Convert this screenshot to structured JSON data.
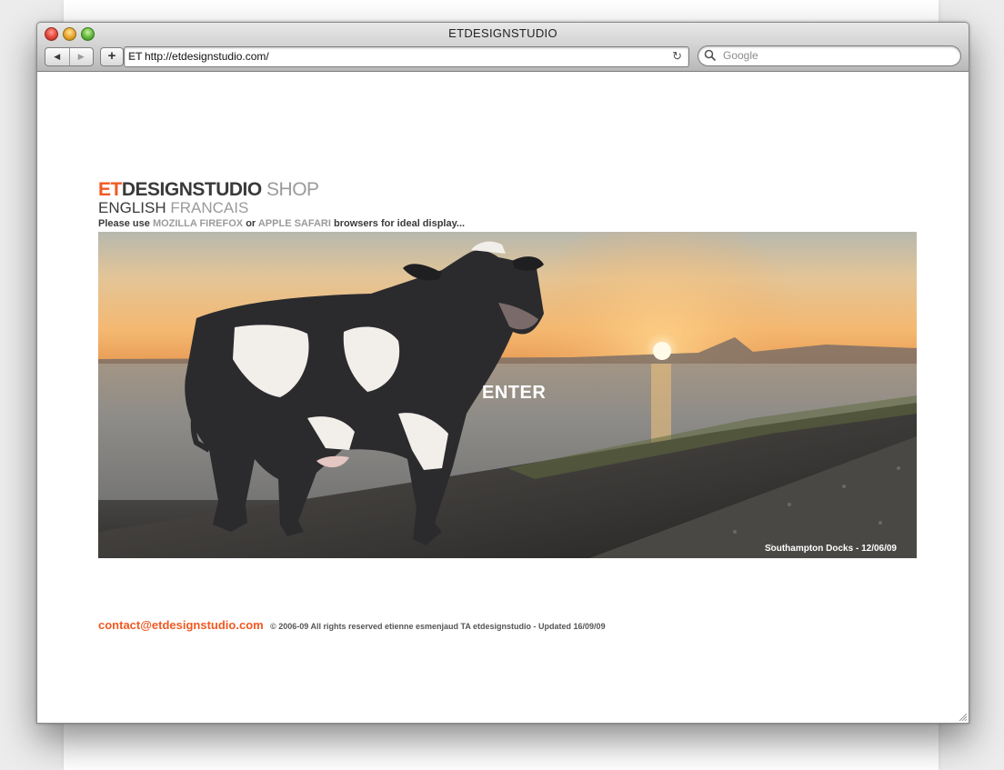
{
  "window": {
    "title": "ETDESIGNSTUDIO"
  },
  "toolbar": {
    "back_label": "◀",
    "forward_label": "▶",
    "add_label": "+",
    "url": "http://etdesignstudio.com/",
    "favicon_text": "ET",
    "search_placeholder": "Google"
  },
  "header": {
    "logo_et": "ET",
    "logo_designstudio": "DESIGNSTUDIO",
    "shop_link": "SHOP",
    "lang_english": "ENGLISH",
    "lang_francais": "FRANCAIS",
    "notice_pre": "Please use ",
    "notice_firefox": "MOZILLA FIREFOX",
    "notice_or": " or ",
    "notice_safari": "APPLE SAFARI",
    "notice_post": " browsers for ideal display..."
  },
  "hero": {
    "enter_label": "ENTER",
    "caption": "Southampton Docks - 12/06/09"
  },
  "footer": {
    "email": "contact@etdesignstudio.com",
    "copyright": "© 2006-09 All rights reserved etienne esmenjaud TA etdesignstudio - Updated 16/09/09"
  },
  "colors": {
    "accent": "#f15a22",
    "text_dark": "#3a3a3a",
    "text_muted": "#9b9b9b"
  },
  "icons": [
    "back-arrow-icon",
    "forward-arrow-icon",
    "plus-icon",
    "reload-icon",
    "search-icon",
    "resize-grip-icon"
  ]
}
